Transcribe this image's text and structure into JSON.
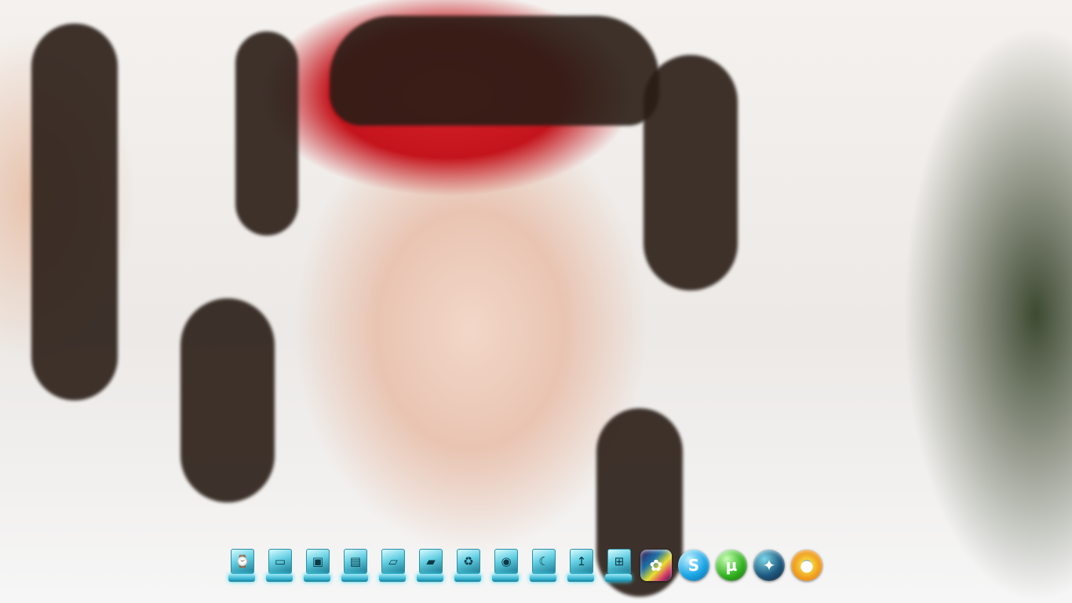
{
  "desktop": {
    "wallpaper": "photo-portrait-wallpaper"
  },
  "dock": {
    "items": [
      {
        "name": "clock-icon",
        "glyph": "⌚"
      },
      {
        "name": "computer-icon",
        "glyph": "▭"
      },
      {
        "name": "monitor-icon",
        "glyph": "▣"
      },
      {
        "name": "network-icon",
        "glyph": "▤"
      },
      {
        "name": "folder-icon",
        "glyph": "▱"
      },
      {
        "name": "documents-folder-icon",
        "glyph": "▰"
      },
      {
        "name": "recycle-bin-icon",
        "glyph": "♻"
      },
      {
        "name": "media-player-icon",
        "glyph": "◉"
      },
      {
        "name": "moon-icon",
        "glyph": "☾"
      },
      {
        "name": "app-icon",
        "glyph": "↥"
      },
      {
        "name": "windows-icon",
        "glyph": "⊞"
      }
    ],
    "apps": [
      {
        "name": "media-visualizer-icon",
        "class": "media",
        "glyph": "✿"
      },
      {
        "name": "skype-icon",
        "class": "skype",
        "glyph": "S"
      },
      {
        "name": "utorrent-icon",
        "class": "utorrent",
        "glyph": "µ"
      },
      {
        "name": "visualizer-icon",
        "class": "visualizer",
        "glyph": "✦"
      },
      {
        "name": "chrome-icon",
        "class": "chrome",
        "glyph": "●"
      }
    ]
  }
}
